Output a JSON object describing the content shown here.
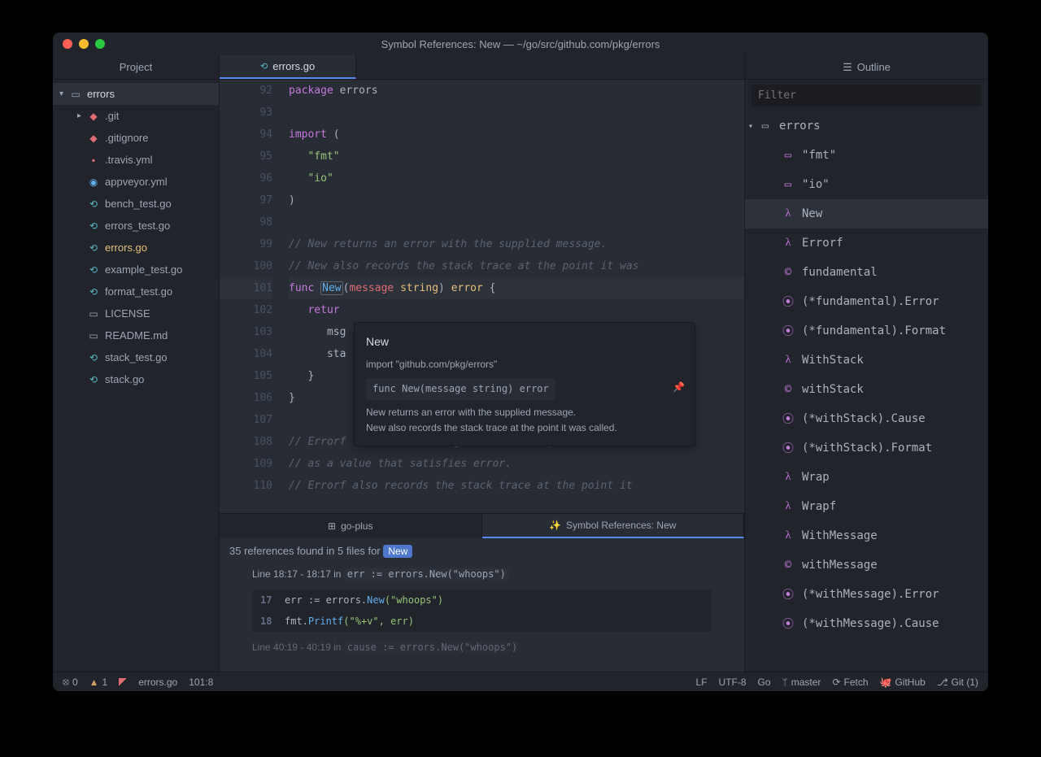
{
  "title": "Symbol References: New — ~/go/src/github.com/pkg/errors",
  "sidebar": {
    "header": "Project",
    "root": "errors",
    "items": [
      {
        "label": ".git",
        "icon": "git",
        "expandable": true
      },
      {
        "label": ".gitignore",
        "icon": "git"
      },
      {
        "label": ".travis.yml",
        "icon": "travis"
      },
      {
        "label": "appveyor.yml",
        "icon": "yml"
      },
      {
        "label": "bench_test.go",
        "icon": "go"
      },
      {
        "label": "errors_test.go",
        "icon": "go"
      },
      {
        "label": "errors.go",
        "icon": "go",
        "selected": true
      },
      {
        "label": "example_test.go",
        "icon": "go"
      },
      {
        "label": "format_test.go",
        "icon": "go"
      },
      {
        "label": "LICENSE",
        "icon": "lic"
      },
      {
        "label": "README.md",
        "icon": "md"
      },
      {
        "label": "stack_test.go",
        "icon": "go"
      },
      {
        "label": "stack.go",
        "icon": "go"
      }
    ]
  },
  "editor": {
    "tab_label": "errors.go",
    "gutter": [
      "92",
      "93",
      "94",
      "95",
      "96",
      "97",
      "98",
      "99",
      "100",
      "101",
      "102",
      "103",
      "104",
      "105",
      "106",
      "107",
      "108",
      "109",
      "110"
    ],
    "code": {
      "l92": {
        "kw": "package",
        "ident": " errors"
      },
      "l94": {
        "kw": "import",
        "paren": " ("
      },
      "l95": "   \"fmt\"",
      "l96": "   \"io\"",
      "l97": ")",
      "l99": "// New returns an error with the supplied message.",
      "l100": "// New also records the stack trace at the point it was",
      "l101": {
        "kw": "func ",
        "fn": "New",
        "sig_open": "(",
        "param": "message",
        "ptype": " string",
        "sig_close": ") ",
        "ret": "error",
        "brace": " {"
      },
      "l102": "   retur",
      "l103": "      msg",
      "l104": "      sta",
      "l105": "   }",
      "l106": "}",
      "l108": "// Errorf formats according to a format specifier and r",
      "l109": "// as a value that satisfies error.",
      "l110": "// Errorf also records the stack trace at the point it "
    }
  },
  "hover": {
    "title": "New",
    "import": "import \"github.com/pkg/errors\"",
    "sig": "func New(message string) error",
    "doc1": "New returns an error with the supplied message.",
    "doc2": "New also records the stack trace at the point it was called."
  },
  "bottom": {
    "tab1": "go-plus",
    "tab2": "Symbol References: New",
    "summary_prefix": "35 references found in 5 files for ",
    "summary_badge": "New",
    "ref1_loc": "Line 18:17 - 18:17 in",
    "ref1_code": "err := errors.New(\"whoops\")",
    "block1": [
      {
        "ln": "17",
        "pre": "err := errors.",
        "hl": "New",
        "post": "(\"whoops\")"
      },
      {
        "ln": "18",
        "pre": "fmt.",
        "hl": "Printf",
        "post": "(\"%+v\", err)"
      }
    ],
    "ref2_loc": "Line 40:19 - 40:19 in",
    "ref2_code": "cause := errors.New(\"whoops\")"
  },
  "outline": {
    "header": "Outline",
    "filter_placeholder": "Filter",
    "root": "errors",
    "items": [
      {
        "icon": "import",
        "label": "\"fmt\""
      },
      {
        "icon": "import",
        "label": "\"io\""
      },
      {
        "icon": "lambda",
        "label": "New",
        "selected": true
      },
      {
        "icon": "lambda",
        "label": "Errorf"
      },
      {
        "icon": "copyright",
        "label": "fundamental"
      },
      {
        "icon": "method",
        "label": "(*fundamental).Error"
      },
      {
        "icon": "method",
        "label": "(*fundamental).Format"
      },
      {
        "icon": "lambda",
        "label": "WithStack"
      },
      {
        "icon": "copyright",
        "label": "withStack"
      },
      {
        "icon": "method",
        "label": "(*withStack).Cause"
      },
      {
        "icon": "method",
        "label": "(*withStack).Format"
      },
      {
        "icon": "lambda",
        "label": "Wrap"
      },
      {
        "icon": "lambda",
        "label": "Wrapf"
      },
      {
        "icon": "lambda",
        "label": "WithMessage"
      },
      {
        "icon": "copyright",
        "label": "withMessage"
      },
      {
        "icon": "method",
        "label": "(*withMessage).Error"
      },
      {
        "icon": "method",
        "label": "(*withMessage).Cause"
      }
    ]
  },
  "status": {
    "errors": "0",
    "warnings": "1",
    "file": "errors.go",
    "cursor": "101:8",
    "eol": "LF",
    "encoding": "UTF-8",
    "lang": "Go",
    "branch": "master",
    "fetch": "Fetch",
    "github": "GitHub",
    "git": "Git (1)"
  }
}
